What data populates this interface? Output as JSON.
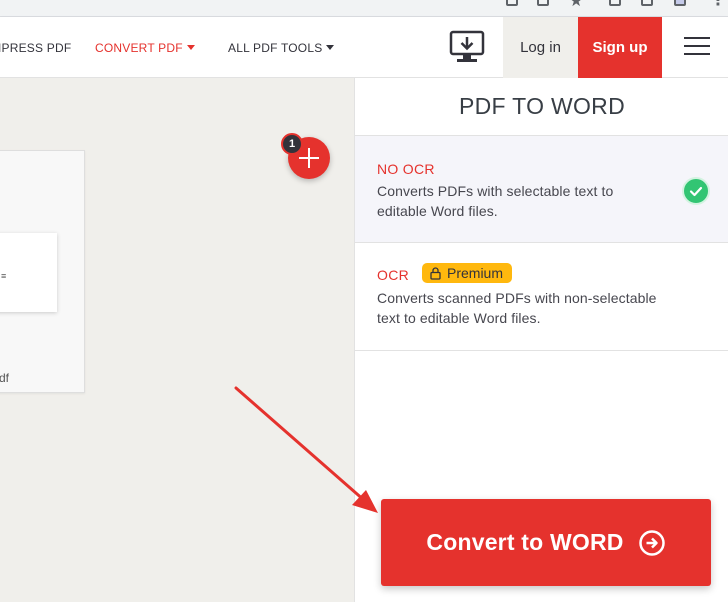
{
  "header": {
    "nav": {
      "compress": "IPRESS PDF",
      "convert": "CONVERT PDF",
      "all_tools": "ALL PDF TOOLS"
    },
    "login_label": "Log in",
    "signup_label": "Sign up",
    "desktop_icon": "desktop-download-icon",
    "menu_icon": "hamburger-menu-icon"
  },
  "workspace": {
    "file_name_fragment": "df",
    "file_count_badge": "1",
    "add_icon": "plus-icon"
  },
  "sidebar": {
    "title": "PDF TO WORD",
    "options": [
      {
        "title": "NO OCR",
        "description": "Converts PDFs with selectable text to editable Word files.",
        "selected": true
      },
      {
        "title": "OCR",
        "premium_label": "Premium",
        "description": "Converts scanned PDFs with non-selectable text to editable Word files.",
        "selected": false
      }
    ],
    "convert_label": "Convert to WORD"
  },
  "colors": {
    "brand_red": "#e5322d",
    "success_green": "#32c573",
    "premium_yellow": "#ffb80e",
    "workspace_bg": "#f0efeb"
  }
}
